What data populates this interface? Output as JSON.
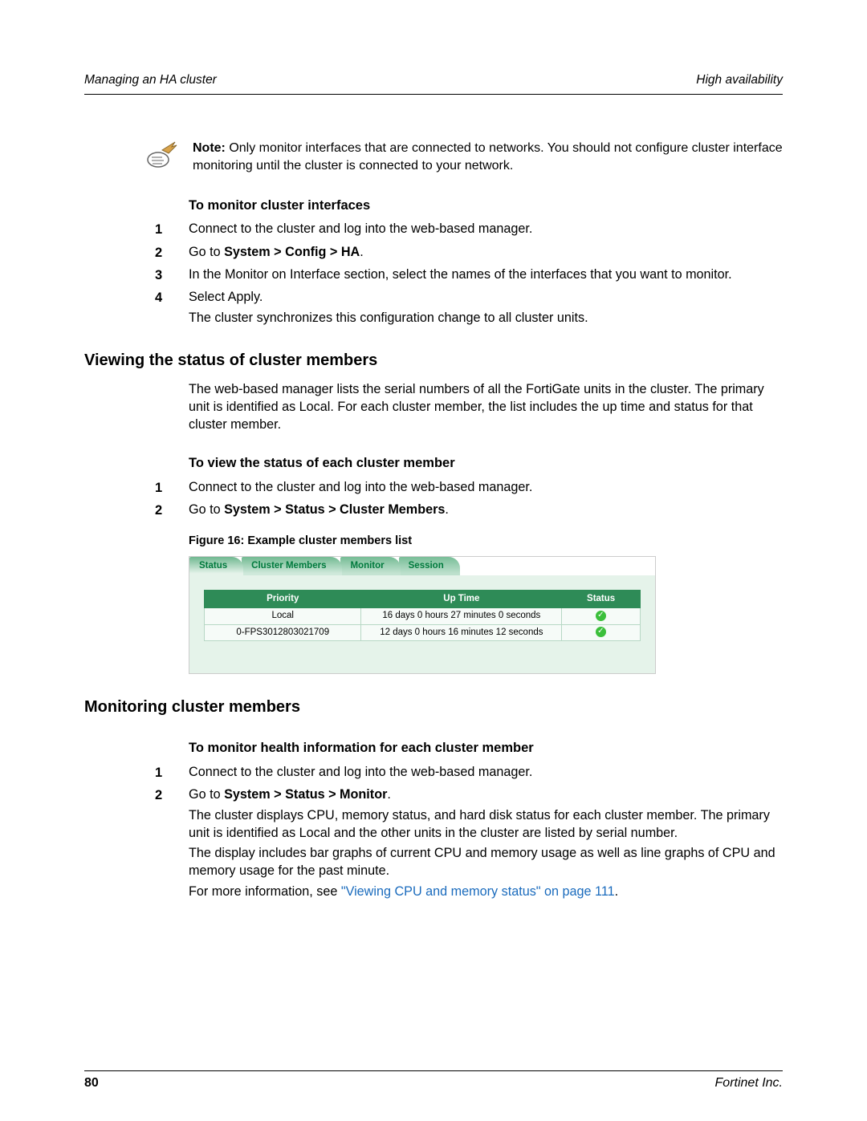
{
  "header": {
    "left": "Managing an HA cluster",
    "right": "High availability"
  },
  "note": {
    "label": "Note:",
    "text": " Only monitor interfaces that are connected to networks. You should not configure cluster interface monitoring until the cluster is connected to your network."
  },
  "sec1": {
    "subhead": "To monitor cluster interfaces",
    "steps": [
      {
        "n": "1",
        "p": [
          {
            "t": "Connect to the cluster and log into the web-based manager."
          }
        ]
      },
      {
        "n": "2",
        "p": [
          {
            "pre": "Go to ",
            "b": "System > Config > HA",
            "post": "."
          }
        ]
      },
      {
        "n": "3",
        "p": [
          {
            "t": "In the Monitor on Interface section, select the names of the interfaces that you want to monitor."
          }
        ]
      },
      {
        "n": "4",
        "p": [
          {
            "t": "Select Apply."
          },
          {
            "t": "The cluster synchronizes this configuration change to all cluster units."
          }
        ]
      }
    ]
  },
  "sec2": {
    "heading": "Viewing the status of cluster members",
    "intro": "The web-based manager lists the serial numbers of all the FortiGate units in the cluster. The primary unit is identified as Local. For each cluster member, the list includes the up time and status for that cluster member.",
    "subhead": "To view the status of each cluster member",
    "steps": [
      {
        "n": "1",
        "p": [
          {
            "t": "Connect to the cluster and log into the web-based manager."
          }
        ]
      },
      {
        "n": "2",
        "p": [
          {
            "pre": "Go to ",
            "b": "System > Status > Cluster Members",
            "post": "."
          }
        ]
      }
    ],
    "figcap": "Figure 16: Example cluster members list",
    "tabs": [
      "Status",
      "Cluster Members",
      "Monitor",
      "Session"
    ],
    "columns": [
      "Priority",
      "Up Time",
      "Status"
    ],
    "rows": [
      {
        "priority": "Local",
        "uptime": "16 days 0 hours 27 minutes 0 seconds",
        "status": "ok"
      },
      {
        "priority": "0-FPS3012803021709",
        "uptime": "12 days 0 hours 16 minutes 12 seconds",
        "status": "ok"
      }
    ]
  },
  "sec3": {
    "heading": "Monitoring cluster members",
    "subhead": "To monitor health information for each cluster member",
    "steps": [
      {
        "n": "1",
        "p": [
          {
            "t": "Connect to the cluster and log into the web-based manager."
          }
        ]
      },
      {
        "n": "2",
        "p": [
          {
            "pre": "Go to ",
            "b": "System > Status > Monitor",
            "post": "."
          },
          {
            "t": "The cluster displays CPU, memory status, and hard disk status for each cluster member. The primary unit is identified as Local and the other units in the cluster are listed by serial number."
          },
          {
            "t": "The display includes bar graphs of current CPU and memory usage as well as line graphs of CPU and memory usage for the past minute."
          },
          {
            "link_pre": "For more information, see ",
            "link": "\"Viewing CPU and memory status\" on page 111",
            "link_post": "."
          }
        ]
      }
    ]
  },
  "colors": {
    "head_green": "#2e8b57"
  },
  "footer": {
    "page": "80",
    "company": "Fortinet Inc."
  }
}
